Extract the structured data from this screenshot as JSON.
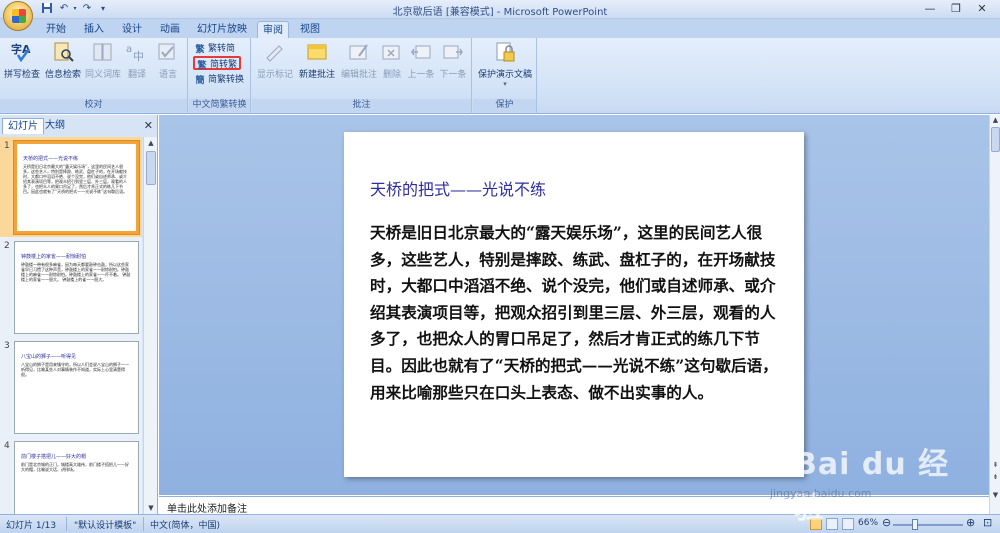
{
  "window": {
    "title": "北京歇后语 [兼容模式] - Microsoft PowerPoint",
    "qat": {
      "save_icon": "save-icon",
      "undo_icon": "undo-icon",
      "redo_icon": "redo-icon",
      "customize_icon": "qat-dropdown-icon"
    },
    "controls": {
      "minimize": "—",
      "restore": "❐",
      "close": "✕"
    }
  },
  "tabs": [
    "开始",
    "插入",
    "设计",
    "动画",
    "幻灯片放映",
    "审阅",
    "视图"
  ],
  "active_tab": "审阅",
  "ribbon": {
    "proofing": {
      "label": "校对",
      "spell_check": "拼写检查",
      "research": "信息检索",
      "thesaurus": "同义词库",
      "translate": "翻译",
      "language": "语言"
    },
    "chinese_conversion": {
      "label": "中文简繁转换",
      "t2s": "繁转简",
      "s2t": "简转繁",
      "convert": "简繁转换"
    },
    "comments": {
      "label": "批注",
      "show_markup": "显示标记",
      "new_comment": "新建批注",
      "edit_comment": "编辑批注",
      "delete": "删除",
      "previous": "上一条",
      "next": "下一条"
    },
    "protect": {
      "label": "保护",
      "protect_presentation": "保护演示文稿"
    }
  },
  "panel": {
    "tab_slides": "幻灯片",
    "tab_outline": "大纲",
    "close": "✕",
    "thumbnails": [
      {
        "num": "1",
        "title": "天桥的把式——光说不练",
        "body": "天桥是旧日北京最大的“露天娱乐场”，这里的民间艺人很多，这些艺人，特别是摔跤、练武、盘杠子的，在开场献技时，大都口中滔滔不绝、说个没完，他们或自述师承、或介绍其表演项目等，把观众招引到里三层、外三层，观看的人多了，也把众人的胃口吊足了，然后才肯正式的练几下节目。因此也就有了“天桥的把式——光说不练”这句歇后语。"
      },
      {
        "num": "2",
        "title": "钟鼓楼上的家雀——耐惊耐怕",
        "body": "钟鼓楼一带有很多麻雀，因为每天都要敲钟击鼓，所以这些家雀早已习惯了这种声音，钟鼓楼上的家雀——耐惊耐怕。钟鼓楼上的麻雀——耐惊耐怕。钟鼓楼上的家雀——吓不着。 钟鼓楼上的家雀——胆大。 钟鼓楼上的雀——胆大。"
      },
      {
        "num": "3",
        "title": "八宝山的狮子——听得见",
        "body": "八宝山的狮子是用来镇守的，所以人们会说八宝山的狮子——听得见，比喻某些人对事情装作不知道，实际上心里清楚得很。"
      },
      {
        "num": "4",
        "title": "前门楼子搭把儿——好大的帽",
        "body": "前门是北京城的正门，城楼高大雄伟，前门楼子搭把儿——好大的帽，比喻说大话、讲排场。"
      }
    ]
  },
  "slide": {
    "title": "天桥的把式——光说不练",
    "body": "天桥是旧日北京最大的“露天娱乐场”，这里的民间艺人很多，这些艺人，特别是摔跤、练武、盘杠子的，在开场献技时，大都口中滔滔不绝、说个没完，他们或自述师承、或介绍其表演项目等，把观众招引到里三层、外三层，观看的人多了，也把众人的胃口吊足了，然后才肯正式的练几下节目。因此也就有了“天桥的把式——光说不练”这句歇后语，用来比喻那些只在口头上表态、做不出实事的人。"
  },
  "notes": {
    "placeholder": "单击此处添加备注"
  },
  "status": {
    "slide": "幻灯片 1/13",
    "theme": "\"默认设计模板\"",
    "language": "中文(简体，中国)",
    "zoom": "66%",
    "zoom_level": 0.66
  },
  "watermark": {
    "brand": "Bai du 经验",
    "url": "jingyan.baidu.com"
  }
}
